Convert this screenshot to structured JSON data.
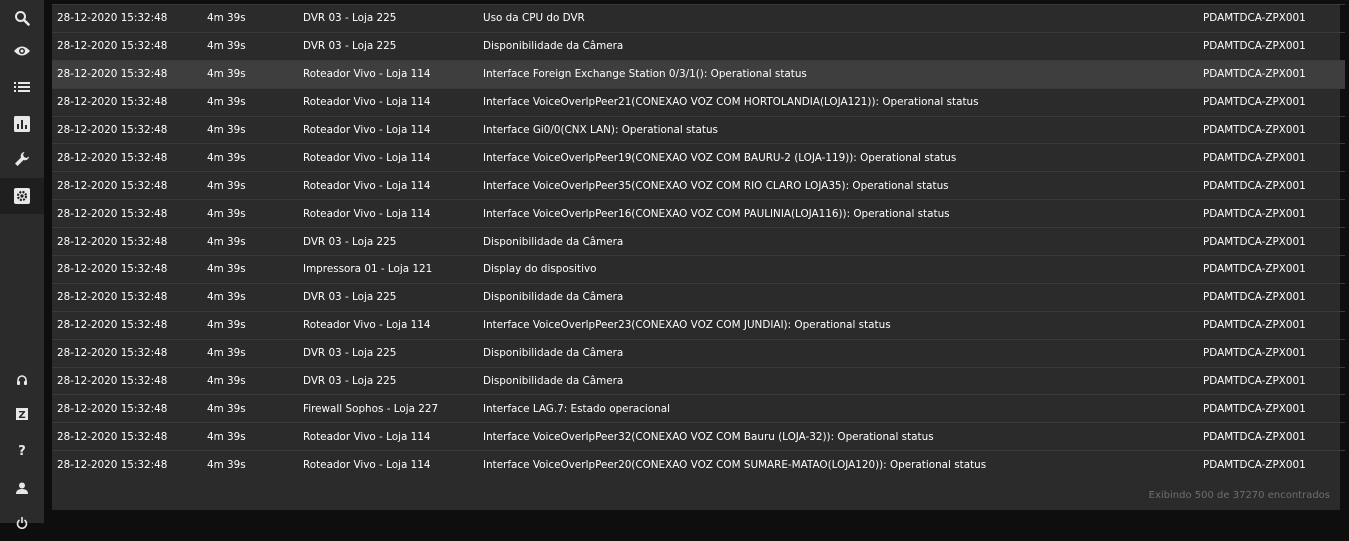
{
  "sidebar": {
    "icons": [
      "search-icon",
      "eye-icon",
      "list-icon",
      "chart-icon",
      "wrench-icon",
      "settings-icon",
      "headset-icon",
      "zabbix-icon",
      "help-icon",
      "user-icon",
      "power-icon"
    ],
    "bottom_letter": "Z",
    "help_glyph": "?"
  },
  "events": {
    "rows": [
      {
        "time": "28-12-2020 15:32:48",
        "duration": "4m 39s",
        "host": "DVR 03 - Loja 225",
        "problem": "Uso da CPU do DVR",
        "proxy": "PDAMTDCA-ZPX001"
      },
      {
        "time": "28-12-2020 15:32:48",
        "duration": "4m 39s",
        "host": "DVR 03 - Loja 225",
        "problem": "Disponibilidade da Câmera",
        "proxy": "PDAMTDCA-ZPX001"
      },
      {
        "time": "28-12-2020 15:32:48",
        "duration": "4m 39s",
        "host": "Roteador Vivo - Loja 114",
        "problem": "Interface Foreign Exchange Station 0/3/1(): Operational status",
        "proxy": "PDAMTDCA-ZPX001"
      },
      {
        "time": "28-12-2020 15:32:48",
        "duration": "4m 39s",
        "host": "Roteador Vivo - Loja 114",
        "problem": "Interface VoiceOverIpPeer21(CONEXAO VOZ COM HORTOLANDIA(LOJA121)): Operational status",
        "proxy": "PDAMTDCA-ZPX001"
      },
      {
        "time": "28-12-2020 15:32:48",
        "duration": "4m 39s",
        "host": "Roteador Vivo - Loja 114",
        "problem": "Interface Gi0/0(CNX LAN): Operational status",
        "proxy": "PDAMTDCA-ZPX001"
      },
      {
        "time": "28-12-2020 15:32:48",
        "duration": "4m 39s",
        "host": "Roteador Vivo - Loja 114",
        "problem": "Interface VoiceOverIpPeer19(CONEXAO VOZ COM BAURU-2 (LOJA-119)): Operational status",
        "proxy": "PDAMTDCA-ZPX001"
      },
      {
        "time": "28-12-2020 15:32:48",
        "duration": "4m 39s",
        "host": "Roteador Vivo - Loja 114",
        "problem": "Interface VoiceOverIpPeer35(CONEXAO VOZ COM RIO CLARO LOJA35): Operational status",
        "proxy": "PDAMTDCA-ZPX001"
      },
      {
        "time": "28-12-2020 15:32:48",
        "duration": "4m 39s",
        "host": "Roteador Vivo - Loja 114",
        "problem": "Interface VoiceOverIpPeer16(CONEXAO VOZ COM PAULINIA(LOJA116)): Operational status",
        "proxy": "PDAMTDCA-ZPX001"
      },
      {
        "time": "28-12-2020 15:32:48",
        "duration": "4m 39s",
        "host": "DVR 03 - Loja 225",
        "problem": "Disponibilidade da Câmera",
        "proxy": "PDAMTDCA-ZPX001"
      },
      {
        "time": "28-12-2020 15:32:48",
        "duration": "4m 39s",
        "host": "Impressora 01 - Loja 121",
        "problem": "Display do dispositivo",
        "proxy": "PDAMTDCA-ZPX001"
      },
      {
        "time": "28-12-2020 15:32:48",
        "duration": "4m 39s",
        "host": "DVR 03 - Loja 225",
        "problem": "Disponibilidade da Câmera",
        "proxy": "PDAMTDCA-ZPX001"
      },
      {
        "time": "28-12-2020 15:32:48",
        "duration": "4m 39s",
        "host": "Roteador Vivo - Loja 114",
        "problem": "Interface VoiceOverIpPeer23(CONEXAO VOZ COM JUNDIAI): Operational status",
        "proxy": "PDAMTDCA-ZPX001"
      },
      {
        "time": "28-12-2020 15:32:48",
        "duration": "4m 39s",
        "host": "DVR 03 - Loja 225",
        "problem": "Disponibilidade da Câmera",
        "proxy": "PDAMTDCA-ZPX001"
      },
      {
        "time": "28-12-2020 15:32:48",
        "duration": "4m 39s",
        "host": "DVR 03 - Loja 225",
        "problem": "Disponibilidade da Câmera",
        "proxy": "PDAMTDCA-ZPX001"
      },
      {
        "time": "28-12-2020 15:32:48",
        "duration": "4m 39s",
        "host": "Firewall Sophos - Loja 227",
        "problem": "Interface LAG.7: Estado operacional",
        "proxy": "PDAMTDCA-ZPX001"
      },
      {
        "time": "28-12-2020 15:32:48",
        "duration": "4m 39s",
        "host": "Roteador Vivo - Loja 114",
        "problem": "Interface VoiceOverIpPeer32(CONEXAO VOZ COM Bauru (LOJA-32)): Operational status",
        "proxy": "PDAMTDCA-ZPX001"
      },
      {
        "time": "28-12-2020 15:32:48",
        "duration": "4m 39s",
        "host": "Roteador Vivo - Loja 114",
        "problem": "Interface VoiceOverIpPeer20(CONEXAO VOZ COM SUMARE-MATAO(LOJA120)): Operational status",
        "proxy": "PDAMTDCA-ZPX001"
      }
    ],
    "highlighted_row": 2
  },
  "footer": {
    "summary": "Exibindo 500 de 37270 encontrados"
  }
}
